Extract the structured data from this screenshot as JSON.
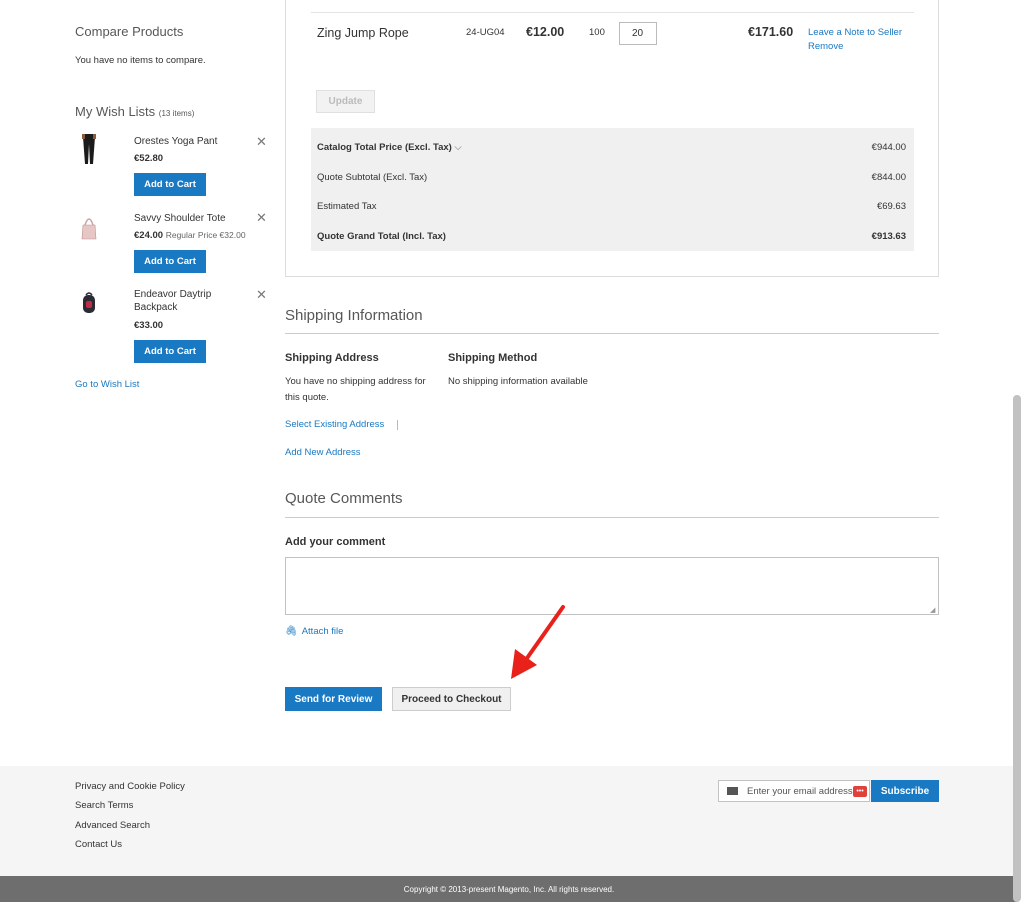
{
  "sidebar": {
    "compare": {
      "title": "Compare Products",
      "empty_text": "You have no items to compare."
    },
    "wishlist": {
      "title": "My Wish Lists",
      "count": "(13 items)",
      "items": [
        {
          "name": "Orestes Yoga Pant",
          "price": "€52.80",
          "regular": "",
          "button": "Add to Cart",
          "thumb": "pants-icon"
        },
        {
          "name": "Savvy Shoulder Tote",
          "price": "€24.00",
          "regular": "Regular Price €32.00",
          "button": "Add to Cart",
          "thumb": "tote-bag-icon"
        },
        {
          "name": "Endeavor Daytrip Backpack",
          "price": "€33.00",
          "regular": "",
          "button": "Add to Cart",
          "thumb": "backpack-icon"
        }
      ],
      "go_link": "Go to Wish List"
    }
  },
  "quote_item": {
    "name": "Zing Jump Rope",
    "sku": "24-UG04",
    "price": "€12.00",
    "original_qty": "100",
    "qty": "20",
    "subtotal": "€171.60",
    "note_link": "Leave a Note to Seller",
    "remove_link": "Remove",
    "update_button": "Update"
  },
  "totals": [
    {
      "label": "Catalog Total Price (Excl. Tax)",
      "value": "€944.00"
    },
    {
      "label": "Quote Subtotal (Excl. Tax)",
      "value": "€844.00"
    },
    {
      "label": "Estimated Tax",
      "value": "€69.63"
    },
    {
      "label": "Quote Grand Total (Incl. Tax)",
      "value": "€913.63"
    }
  ],
  "shipping": {
    "title": "Shipping Information",
    "address_heading": "Shipping Address",
    "address_text": "You have no shipping address for this quote.",
    "select_link": "Select Existing Address",
    "add_link": "Add New Address",
    "method_heading": "Shipping Method",
    "method_text": "No shipping information available"
  },
  "comments": {
    "title": "Quote Comments",
    "label": "Add your comment",
    "textarea_value": "",
    "attach_link": "Attach file"
  },
  "actions": {
    "send": "Send for Review",
    "checkout": "Proceed to Checkout"
  },
  "footer": {
    "links": [
      "Privacy and Cookie Policy",
      "Search Terms",
      "Advanced Search",
      "Contact Us"
    ],
    "newsletter_placeholder": "Enter your email address",
    "subscribe": "Subscribe",
    "copyright": "Copyright © 2013-present Magento, Inc. All rights reserved."
  },
  "colors": {
    "primary": "#1979c3",
    "annotation_arrow": "#e8221a"
  }
}
